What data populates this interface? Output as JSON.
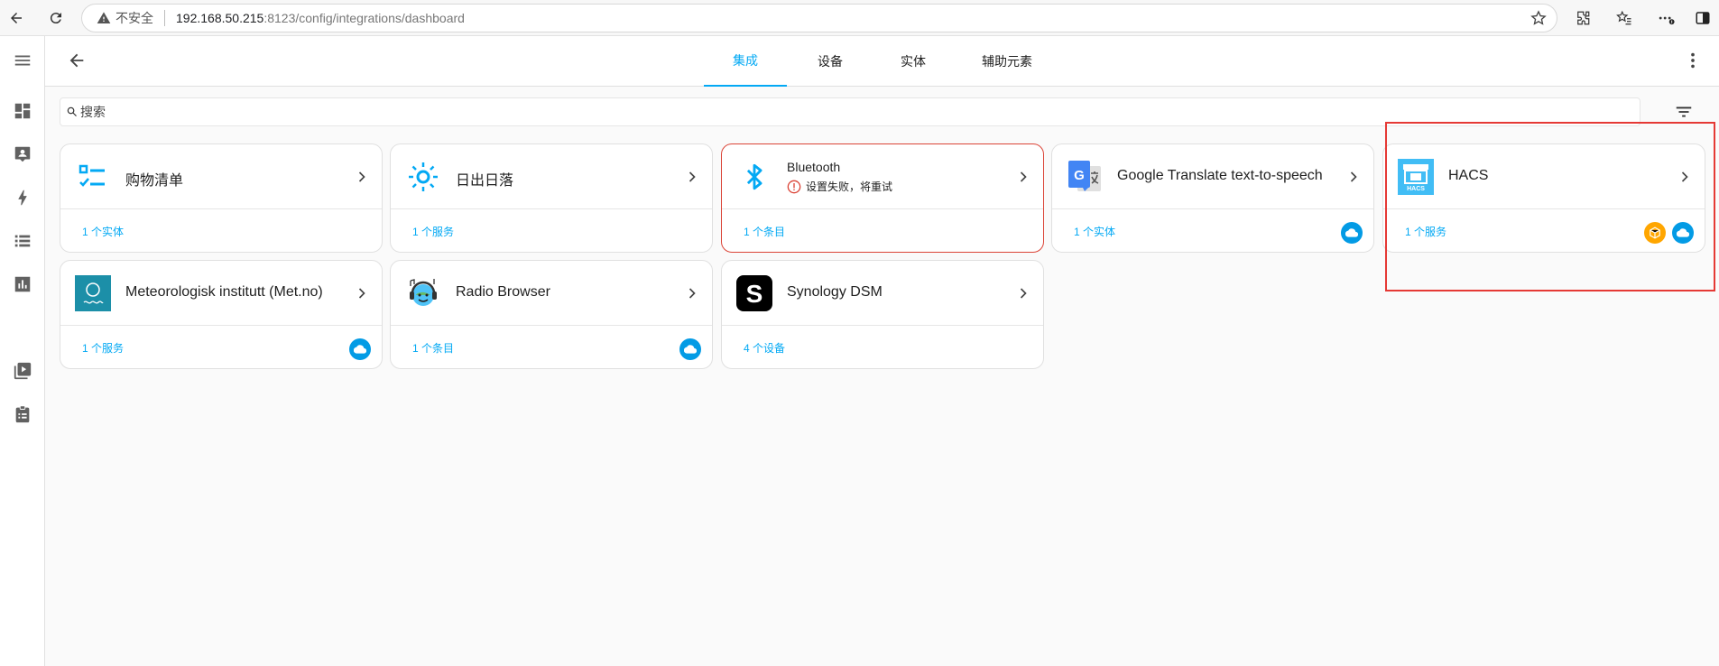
{
  "browser": {
    "security_label": "不安全",
    "url_host": "192.168.50.215",
    "url_path": ":8123/config/integrations/dashboard"
  },
  "tabs": [
    {
      "label": "集成",
      "active": true
    },
    {
      "label": "设备",
      "active": false
    },
    {
      "label": "实体",
      "active": false
    },
    {
      "label": "辅助元素",
      "active": false
    }
  ],
  "search": {
    "placeholder": "搜索"
  },
  "cards": [
    {
      "title": "购物清单",
      "link": "1 个实体",
      "icon": "shopping-list-icon"
    },
    {
      "title": "日出日落",
      "link": "1 个服务",
      "icon": "sun-icon"
    },
    {
      "title": "Bluetooth",
      "error": "设置失败，将重试",
      "link": "1 个条目",
      "icon": "bluetooth-icon"
    },
    {
      "title": "Google Translate text-to-speech",
      "link": "1 个实体",
      "icon": "google-translate-icon",
      "badges": [
        "cloud-icon"
      ]
    },
    {
      "title": "HACS",
      "link": "1 个服务",
      "icon": "hacs-icon",
      "badges": [
        "custom-integration-icon",
        "cloud-icon"
      ]
    },
    {
      "title": "Meteorologisk institutt (Met.no)",
      "link": "1 个服务",
      "icon": "met-no-icon",
      "badges": [
        "cloud-icon"
      ]
    },
    {
      "title": "Radio Browser",
      "link": "1 个条目",
      "icon": "radio-browser-icon",
      "badges": [
        "cloud-icon"
      ]
    },
    {
      "title": "Synology DSM",
      "link": "4 个设备",
      "icon": "synology-icon"
    }
  ],
  "logo_texts": {
    "hacs": "HACS",
    "synology": "S",
    "google": "G"
  },
  "colors": {
    "accent": "#03a9f4",
    "error": "#db4437",
    "highlight": "#e53935",
    "cloud_badge": "#039be5",
    "custom_badge": "#ffa600"
  }
}
